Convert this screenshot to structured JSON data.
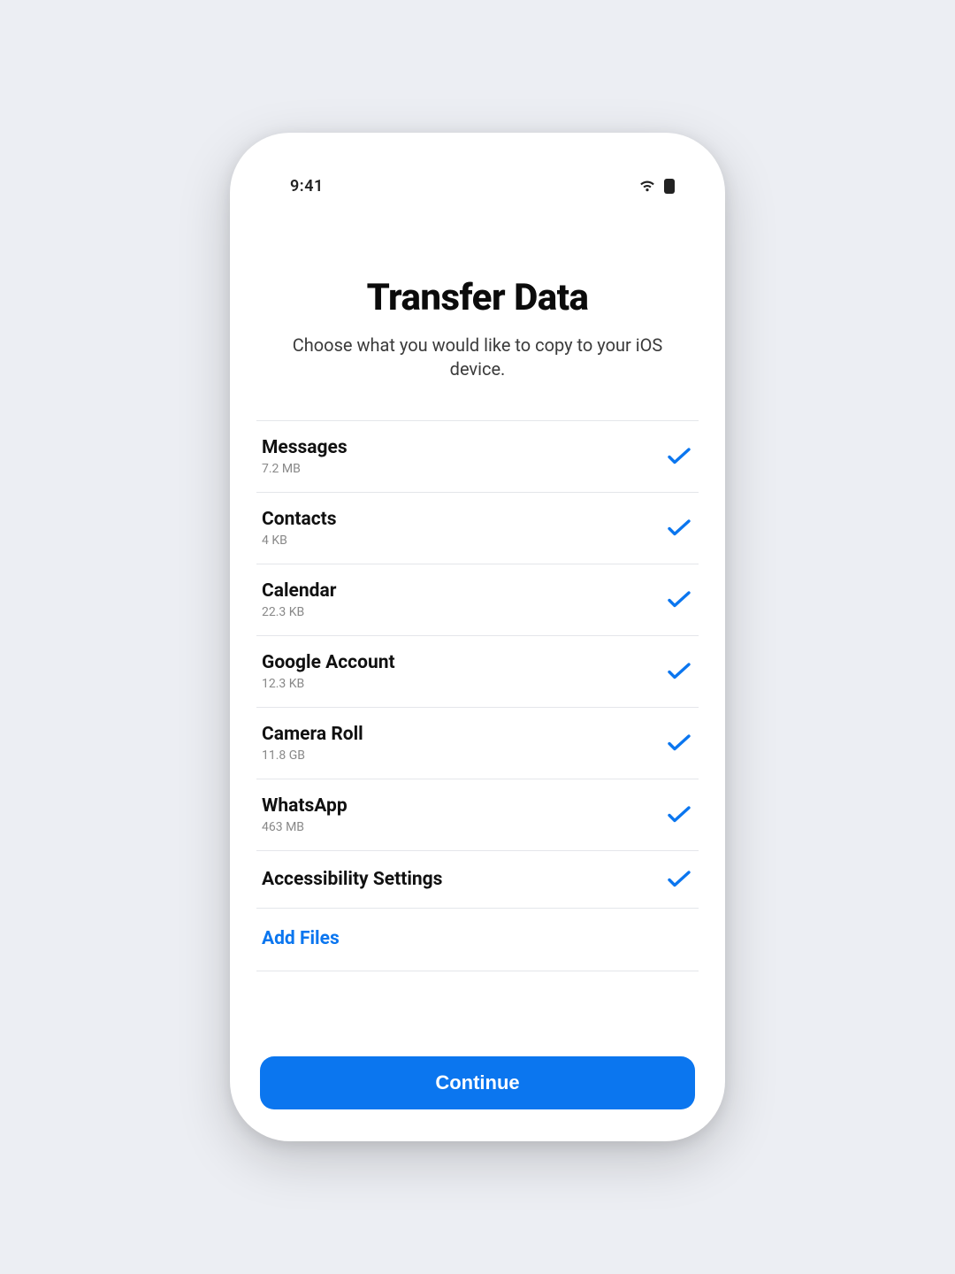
{
  "status": {
    "time": "9:41"
  },
  "header": {
    "title": "Transfer Data",
    "subtitle": "Choose what you would like to copy to your iOS device."
  },
  "items": [
    {
      "label": "Messages",
      "size": "7.2 MB",
      "checked": true
    },
    {
      "label": "Contacts",
      "size": "4 KB",
      "checked": true
    },
    {
      "label": "Calendar",
      "size": "22.3 KB",
      "checked": true
    },
    {
      "label": "Google Account",
      "size": "12.3 KB",
      "checked": true
    },
    {
      "label": "Camera Roll",
      "size": "11.8 GB",
      "checked": true
    },
    {
      "label": "WhatsApp",
      "size": "463 MB",
      "checked": true
    },
    {
      "label": "Accessibility Settings",
      "size": "",
      "checked": true
    }
  ],
  "actions": {
    "add_files": "Add Files",
    "continue": "Continue"
  },
  "colors": {
    "accent": "#0b76ef"
  }
}
